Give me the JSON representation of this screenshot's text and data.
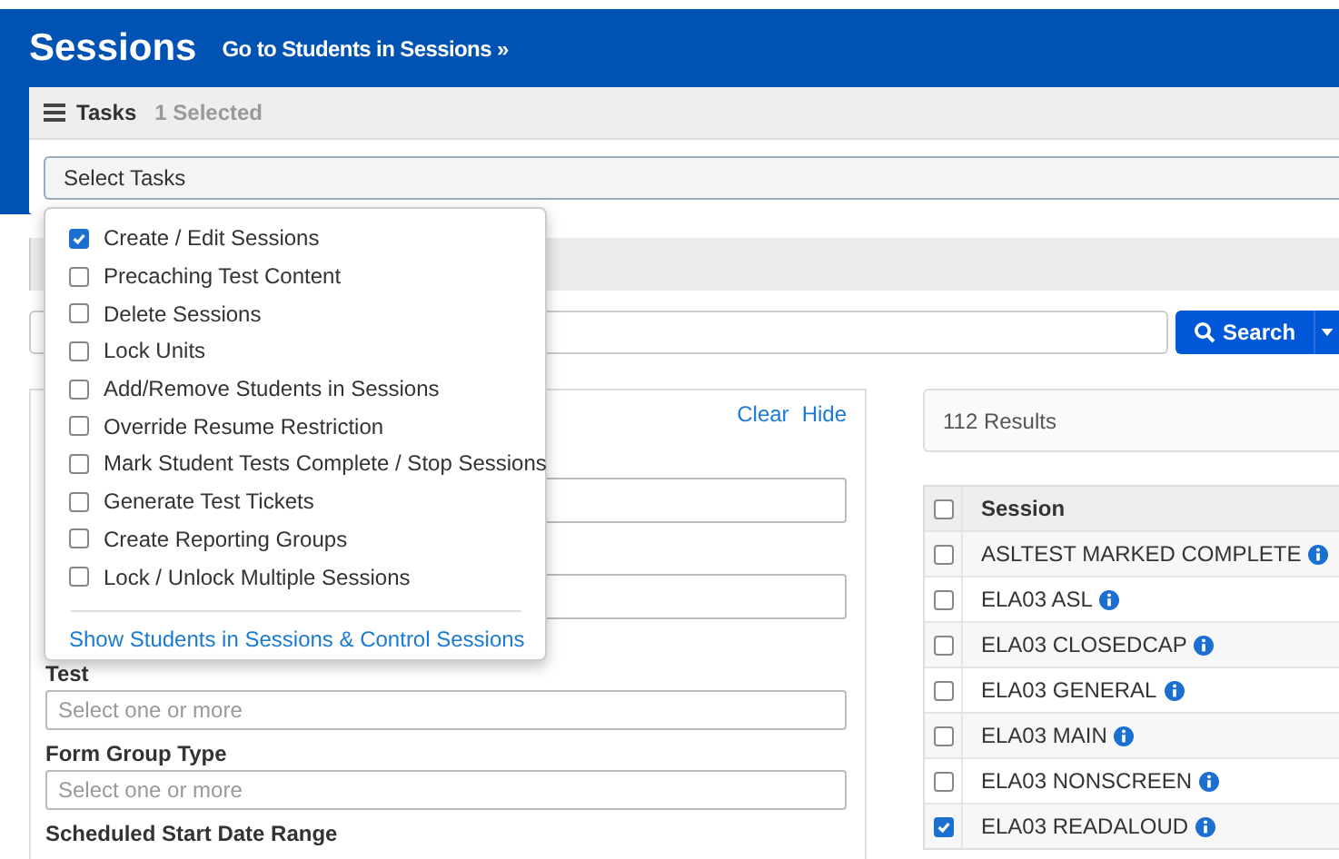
{
  "header": {
    "title": "Sessions",
    "link": "Go to Students in Sessions »"
  },
  "tasks": {
    "title": "Tasks",
    "count": "1 Selected",
    "select_label": "Select Tasks",
    "expanded": true,
    "options": [
      {
        "label": "Create / Edit Sessions",
        "checked": true
      },
      {
        "label": "Precaching Test Content",
        "checked": false
      },
      {
        "label": "Delete Sessions",
        "checked": false
      },
      {
        "label": "Lock Units",
        "checked": false
      },
      {
        "label": "Add/Remove Students in Sessions",
        "checked": false
      },
      {
        "label": "Override Resume Restriction",
        "checked": false
      },
      {
        "label": "Mark Student Tests Complete / Stop Sessions",
        "checked": false
      },
      {
        "label": "Generate Test Tickets",
        "checked": false
      },
      {
        "label": "Create Reporting Groups",
        "checked": false
      },
      {
        "label": "Lock / Unlock Multiple Sessions",
        "checked": false
      }
    ],
    "footer_link": "Show Students in Sessions & Control Sessions"
  },
  "search": {
    "button": "Search"
  },
  "filters": {
    "links": [
      "Clear",
      "Hide"
    ],
    "fields": [
      {
        "label": "Test",
        "placeholder": "Select one or more"
      },
      {
        "label": "Form Group Type",
        "placeholder": "Select one or more"
      }
    ],
    "next_label": "Scheduled Start Date Range"
  },
  "results": {
    "count": "112 Results",
    "column": "Session",
    "all_checked": false,
    "rows": [
      {
        "name": "ASLTEST MARKED COMPLETE",
        "checked": false
      },
      {
        "name": "ELA03 ASL",
        "checked": false
      },
      {
        "name": "ELA03 CLOSEDCAP",
        "checked": false
      },
      {
        "name": "ELA03 GENERAL",
        "checked": false
      },
      {
        "name": "ELA03 MAIN",
        "checked": false
      },
      {
        "name": "ELA03 NONSCREEN",
        "checked": false
      },
      {
        "name": "ELA03 READALOUD",
        "checked": true
      }
    ]
  }
}
